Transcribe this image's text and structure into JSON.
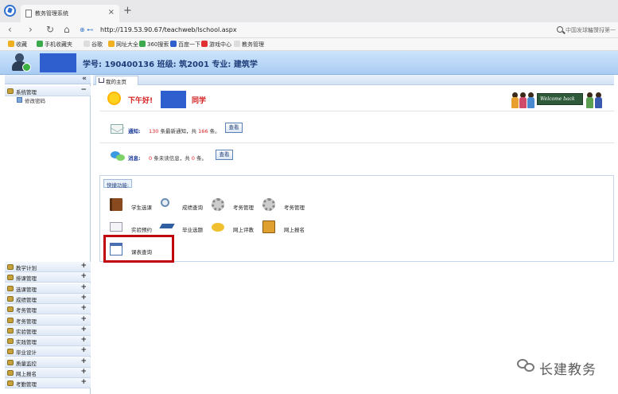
{
  "browser": {
    "tab_title": "教务管理系统",
    "tab_close": "×",
    "new_tab": "+",
    "url": "http://119.53.90.67/teachweb/lschool.aspx",
    "url_prefix_icons": "⊕ ⊷",
    "url_right_controls": "⊞ ⚡ ∨",
    "search_placeholder": "中国发球韩赞打第一",
    "nav": {
      "back": "‹",
      "forward": "›",
      "reload": "↻",
      "home": "⌂"
    }
  },
  "bookmarks": [
    {
      "label": "收藏",
      "color": "#f0b020"
    },
    {
      "label": "手机收藏夹",
      "color": "#3ca94d"
    },
    {
      "label": "谷歌",
      "color": "#dddddd"
    },
    {
      "label": "网址大全",
      "color": "#f0b020"
    },
    {
      "label": "360搜索",
      "color": "#3ca94d"
    },
    {
      "label": "百度一下",
      "color": "#2f5fcf"
    },
    {
      "label": "游戏中心",
      "color": "#e03030"
    },
    {
      "label": "教务管理",
      "color": "#dddddd"
    }
  ],
  "header": {
    "student_info": "学号: 190400136   班级: 筑2001   专业: 建筑学"
  },
  "sidebar": {
    "collapse": "«",
    "top_groups": [
      {
        "label": "系统管理",
        "state": "−"
      }
    ],
    "sub_items": [
      {
        "label": "修改密码"
      }
    ],
    "groups": [
      {
        "label": "教学计划",
        "state": "+"
      },
      {
        "label": "排课管理",
        "state": "+"
      },
      {
        "label": "选课管理",
        "state": "+"
      },
      {
        "label": "成绩管理",
        "state": "+"
      },
      {
        "label": "考务管理",
        "state": "+"
      },
      {
        "label": "考务管理",
        "state": "+"
      },
      {
        "label": "实验管理",
        "state": "+"
      },
      {
        "label": "实践管理",
        "state": "+"
      },
      {
        "label": "毕业设计",
        "state": "+"
      },
      {
        "label": "质量监控",
        "state": "+"
      },
      {
        "label": "网上报名",
        "state": "+"
      },
      {
        "label": "考勤管理",
        "state": "+"
      }
    ]
  },
  "main": {
    "home_tab": "我的主页",
    "greeting": "下午好!",
    "greeting_suffix": "同学",
    "welcome_banner": "Welcome back",
    "notice": {
      "label": "通知:",
      "new_count": "130",
      "middle": "条最新通知，共",
      "total": "166",
      "suffix": "条。",
      "button": "查看"
    },
    "message": {
      "label": "消息:",
      "new_count": "0",
      "middle": "条未读信息，共",
      "total": "0",
      "suffix": "条。",
      "button": "查看"
    },
    "quick_title": "快捷功能:",
    "quick_items": [
      {
        "label": "学生选课",
        "icon": "book-icon"
      },
      {
        "label": "成绩查询",
        "icon": "magnifier-icon"
      },
      {
        "label": "考务管理",
        "icon": "gear-icon"
      },
      {
        "label": "考务管理",
        "icon": "gear-icon"
      },
      {
        "label": "实验预约",
        "icon": "envelope-icon"
      },
      {
        "label": "毕业选题",
        "icon": "graduation-cap-icon"
      },
      {
        "label": "网上评教",
        "icon": "chat-icon"
      },
      {
        "label": "网上报名",
        "icon": "notebook-icon"
      },
      {
        "label": "课表查询",
        "icon": "calendar-icon"
      }
    ]
  },
  "watermark": "长建教务",
  "colors": {
    "accent_red": "#d62020",
    "header_blue": "#a9ccf3",
    "highlight": "#c0000c"
  }
}
